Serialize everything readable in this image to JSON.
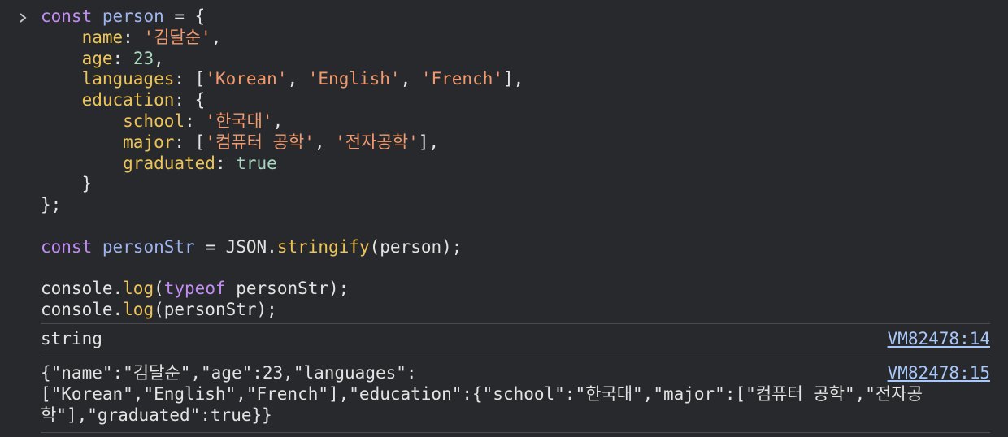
{
  "input": {
    "prompt_icon": "chevron-right-icon",
    "lines": [
      [
        {
          "t": "kw",
          "v": "const"
        },
        {
          "t": "plain",
          "v": " "
        },
        {
          "t": "var",
          "v": "person"
        },
        {
          "t": "plain",
          "v": " = {"
        }
      ],
      [
        {
          "t": "plain",
          "v": "    "
        },
        {
          "t": "prop",
          "v": "name"
        },
        {
          "t": "plain",
          "v": ": "
        },
        {
          "t": "str",
          "v": "'김달순'"
        },
        {
          "t": "plain",
          "v": ","
        }
      ],
      [
        {
          "t": "plain",
          "v": "    "
        },
        {
          "t": "prop",
          "v": "age"
        },
        {
          "t": "plain",
          "v": ": "
        },
        {
          "t": "num",
          "v": "23"
        },
        {
          "t": "plain",
          "v": ","
        }
      ],
      [
        {
          "t": "plain",
          "v": "    "
        },
        {
          "t": "prop",
          "v": "languages"
        },
        {
          "t": "plain",
          "v": ": ["
        },
        {
          "t": "str",
          "v": "'Korean'"
        },
        {
          "t": "plain",
          "v": ", "
        },
        {
          "t": "str",
          "v": "'English'"
        },
        {
          "t": "plain",
          "v": ", "
        },
        {
          "t": "str",
          "v": "'French'"
        },
        {
          "t": "plain",
          "v": "],"
        }
      ],
      [
        {
          "t": "plain",
          "v": "    "
        },
        {
          "t": "prop",
          "v": "education"
        },
        {
          "t": "plain",
          "v": ": {"
        }
      ],
      [
        {
          "t": "plain",
          "v": "        "
        },
        {
          "t": "prop",
          "v": "school"
        },
        {
          "t": "plain",
          "v": ": "
        },
        {
          "t": "str",
          "v": "'한국대'"
        },
        {
          "t": "plain",
          "v": ","
        }
      ],
      [
        {
          "t": "plain",
          "v": "        "
        },
        {
          "t": "prop",
          "v": "major"
        },
        {
          "t": "plain",
          "v": ": ["
        },
        {
          "t": "str",
          "v": "'컴퓨터 공학'"
        },
        {
          "t": "plain",
          "v": ", "
        },
        {
          "t": "str",
          "v": "'전자공학'"
        },
        {
          "t": "plain",
          "v": "],"
        }
      ],
      [
        {
          "t": "plain",
          "v": "        "
        },
        {
          "t": "prop",
          "v": "graduated"
        },
        {
          "t": "plain",
          "v": ": "
        },
        {
          "t": "bool",
          "v": "true"
        }
      ],
      [
        {
          "t": "plain",
          "v": "    }"
        }
      ],
      [
        {
          "t": "plain",
          "v": "};"
        }
      ],
      [
        {
          "t": "plain",
          "v": ""
        }
      ],
      [
        {
          "t": "kw",
          "v": "const"
        },
        {
          "t": "plain",
          "v": " "
        },
        {
          "t": "var",
          "v": "personStr"
        },
        {
          "t": "plain",
          "v": " = JSON."
        },
        {
          "t": "fn",
          "v": "stringify"
        },
        {
          "t": "plain",
          "v": "(person);"
        }
      ],
      [
        {
          "t": "plain",
          "v": ""
        }
      ],
      [
        {
          "t": "plain",
          "v": "console."
        },
        {
          "t": "fn",
          "v": "log"
        },
        {
          "t": "plain",
          "v": "("
        },
        {
          "t": "kw",
          "v": "typeof"
        },
        {
          "t": "plain",
          "v": " personStr);"
        }
      ],
      [
        {
          "t": "plain",
          "v": "console."
        },
        {
          "t": "fn",
          "v": "log"
        },
        {
          "t": "plain",
          "v": "(personStr);"
        }
      ]
    ]
  },
  "outputs": [
    {
      "text": "string",
      "source": "VM82478:14"
    },
    {
      "text": "{\"name\":\"김달순\",\"age\":23,\"languages\":\n[\"Korean\",\"English\",\"French\"],\"education\":{\"school\":\"한국대\",\"major\":[\"컴퓨터 공학\",\"전자공\n학\"],\"graduated\":true}}",
      "source": "VM82478:15"
    }
  ],
  "colors": {
    "background": "#28292c",
    "keyword": "#c28cf5",
    "variable": "#9fb5f0",
    "property": "#ecc45a",
    "string": "#f19a6f",
    "number": "#a8d8c0",
    "link": "#a8c7fa",
    "divider": "#4a4b4f"
  }
}
